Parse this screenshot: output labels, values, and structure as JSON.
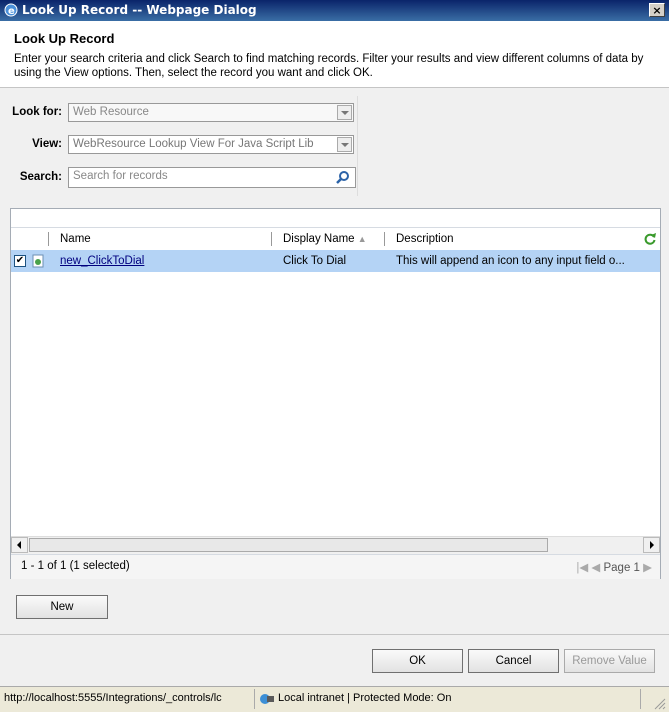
{
  "window": {
    "title": "Look Up Record -- Webpage Dialog",
    "close_label": "×"
  },
  "header": {
    "title": "Look Up Record",
    "description": "Enter your search criteria and click Search to find matching records. Filter your results and view different columns of data by using the View options. Then, select the record you want and click OK."
  },
  "form": {
    "look_for_label": "Look for:",
    "look_for_value": "Web Resource",
    "view_label": "View:",
    "view_value": "WebResource Lookup View For Java Script Lib",
    "search_label": "Search:",
    "search_placeholder": "Search for records"
  },
  "grid": {
    "columns": [
      "Name",
      "Display Name",
      "Description"
    ],
    "sort_indicator": "▲",
    "rows": [
      {
        "checked": "✔",
        "name": "new_ClickToDial",
        "display_name": "Click To Dial",
        "description": "This will append an icon to any input field o..."
      }
    ],
    "record_summary": "1 - 1 of 1 (1 selected)",
    "page_label": "Page 1"
  },
  "buttons": {
    "new": "New",
    "ok": "OK",
    "cancel": "Cancel",
    "remove_value": "Remove Value"
  },
  "status_bar": {
    "url": "http://localhost:5555/Integrations/_controls/lc",
    "zone": "Local intranet | Protected Mode: On"
  },
  "colors": {
    "selected_row": "#b4d3f5",
    "title_bar": "#0a246a"
  }
}
